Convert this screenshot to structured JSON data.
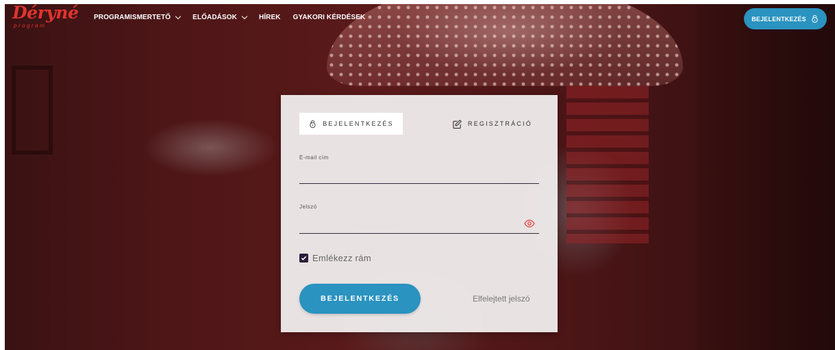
{
  "header": {
    "logo": {
      "brand": "Déryné",
      "sub": "program"
    },
    "nav": [
      {
        "label": "PROGRAMISMERTETŐ",
        "dropdown": true
      },
      {
        "label": "ELŐADÁSOK",
        "dropdown": true
      },
      {
        "label": "HÍREK",
        "dropdown": false
      },
      {
        "label": "GYAKORI KÉRDÉSEK",
        "dropdown": false
      }
    ],
    "login_button": {
      "label": "BEJELENTKEZÉS",
      "icon": "lock-icon"
    }
  },
  "login_card": {
    "tabs": [
      {
        "label": "BEJELENTKEZÉS",
        "icon": "lock-icon",
        "active": true
      },
      {
        "label": "REGISZTRÁCIÓ",
        "icon": "edit-icon",
        "active": false
      }
    ],
    "email": {
      "label": "E-mail cím",
      "value": "",
      "placeholder": ""
    },
    "password": {
      "label": "Jelszó",
      "value": "",
      "placeholder": "",
      "toggle_icon": "eye-icon"
    },
    "remember": {
      "label": "Emlékezz rám",
      "checked": true
    },
    "submit_label": "BEJELENTKEZÉS",
    "forgot_label": "Elfelejtett jelszó"
  },
  "colors": {
    "accent": "#2a93c0",
    "brand": "#e0342f",
    "checkbox": "#2b1d3a"
  }
}
